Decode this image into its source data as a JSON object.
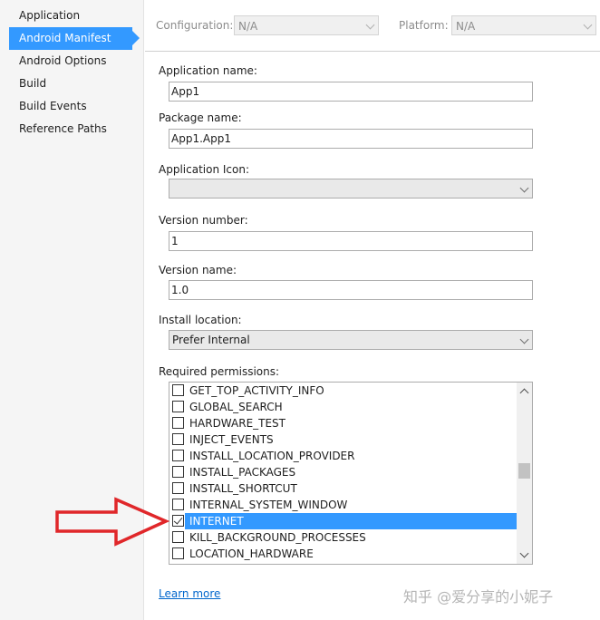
{
  "sidebar": {
    "items": [
      {
        "label": "Application",
        "active": false
      },
      {
        "label": "Android Manifest",
        "active": true
      },
      {
        "label": "Android Options",
        "active": false
      },
      {
        "label": "Build",
        "active": false
      },
      {
        "label": "Build Events",
        "active": false
      },
      {
        "label": "Reference Paths",
        "active": false
      }
    ]
  },
  "topbar": {
    "configuration_label": "Configuration:",
    "configuration_value": "N/A",
    "platform_label": "Platform:",
    "platform_value": "N/A"
  },
  "form": {
    "app_name_label": "Application name:",
    "app_name_value": "App1",
    "package_name_label": "Package name:",
    "package_name_value": "App1.App1",
    "app_icon_label": "Application Icon:",
    "app_icon_value": "",
    "version_number_label": "Version number:",
    "version_number_value": "1",
    "version_name_label": "Version name:",
    "version_name_value": "1.0",
    "install_location_label": "Install location:",
    "install_location_value": "Prefer Internal",
    "permissions_label": "Required permissions:"
  },
  "permissions": [
    {
      "name": "GET_TOP_ACTIVITY_INFO",
      "checked": false,
      "selected": false
    },
    {
      "name": "GLOBAL_SEARCH",
      "checked": false,
      "selected": false
    },
    {
      "name": "HARDWARE_TEST",
      "checked": false,
      "selected": false
    },
    {
      "name": "INJECT_EVENTS",
      "checked": false,
      "selected": false
    },
    {
      "name": "INSTALL_LOCATION_PROVIDER",
      "checked": false,
      "selected": false
    },
    {
      "name": "INSTALL_PACKAGES",
      "checked": false,
      "selected": false
    },
    {
      "name": "INSTALL_SHORTCUT",
      "checked": false,
      "selected": false
    },
    {
      "name": "INTERNAL_SYSTEM_WINDOW",
      "checked": false,
      "selected": false
    },
    {
      "name": "INTERNET",
      "checked": true,
      "selected": true
    },
    {
      "name": "KILL_BACKGROUND_PROCESSES",
      "checked": false,
      "selected": false
    },
    {
      "name": "LOCATION_HARDWARE",
      "checked": false,
      "selected": false
    }
  ],
  "learn_more": "Learn more",
  "watermark": "知乎 @爱分享的小妮子",
  "colors": {
    "accent": "#3399ff",
    "arrow": "#e0272a",
    "link": "#0066cc"
  }
}
